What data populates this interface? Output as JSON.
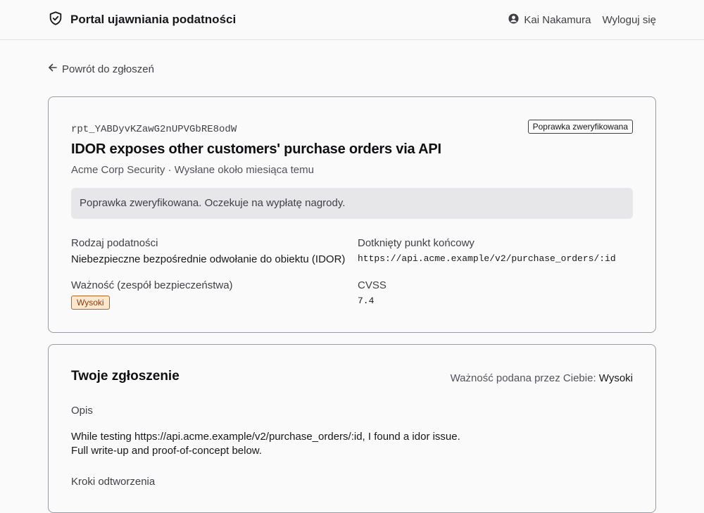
{
  "header": {
    "title": "Portal ujawniania podatności",
    "user_name": "Kai Nakamura",
    "logout_label": "Wyloguj się"
  },
  "back_link": "Powrót do zgłoszeń",
  "report": {
    "id": "rpt_YABDyvKZawG2nUPVGbRE8odW",
    "status_badge": "Poprawka zweryfikowana",
    "title": "IDOR exposes other customers' purchase orders via API",
    "subtitle": "Acme Corp Security · Wysłane około miesiąca temu",
    "notice": "Poprawka zweryfikowana. Oczekuje na wypłatę nagrody.",
    "vuln_type_label": "Rodzaj podatności",
    "vuln_type": "Niebezpieczne bezpośrednie odwołanie do obiektu (IDOR)",
    "endpoint_label": "Dotknięty punkt końcowy",
    "endpoint": "https://api.acme.example/v2/purchase_orders/:id",
    "severity_label": "Ważność (zespół bezpieczeństwa)",
    "severity": "Wysoki",
    "cvss_label": "CVSS",
    "cvss": "7.4"
  },
  "submission": {
    "heading": "Twoje zgłoszenie",
    "reported_severity_label": "Ważność podana przez Ciebie:",
    "reported_severity": "Wysoki",
    "description_label": "Opis",
    "description_line1": "While testing https://api.acme.example/v2/purchase_orders/:id, I found a idor issue.",
    "description_line2": "Full write-up and proof-of-concept below.",
    "steps_label": "Kroki odtworzenia"
  },
  "colors": {
    "severity_bg": "#fde7cf",
    "severity_border": "#b5651d",
    "notice_bg": "#e7e7ea"
  },
  "icons": [
    "shield-check-icon",
    "user-circle-icon",
    "arrow-left-icon"
  ]
}
